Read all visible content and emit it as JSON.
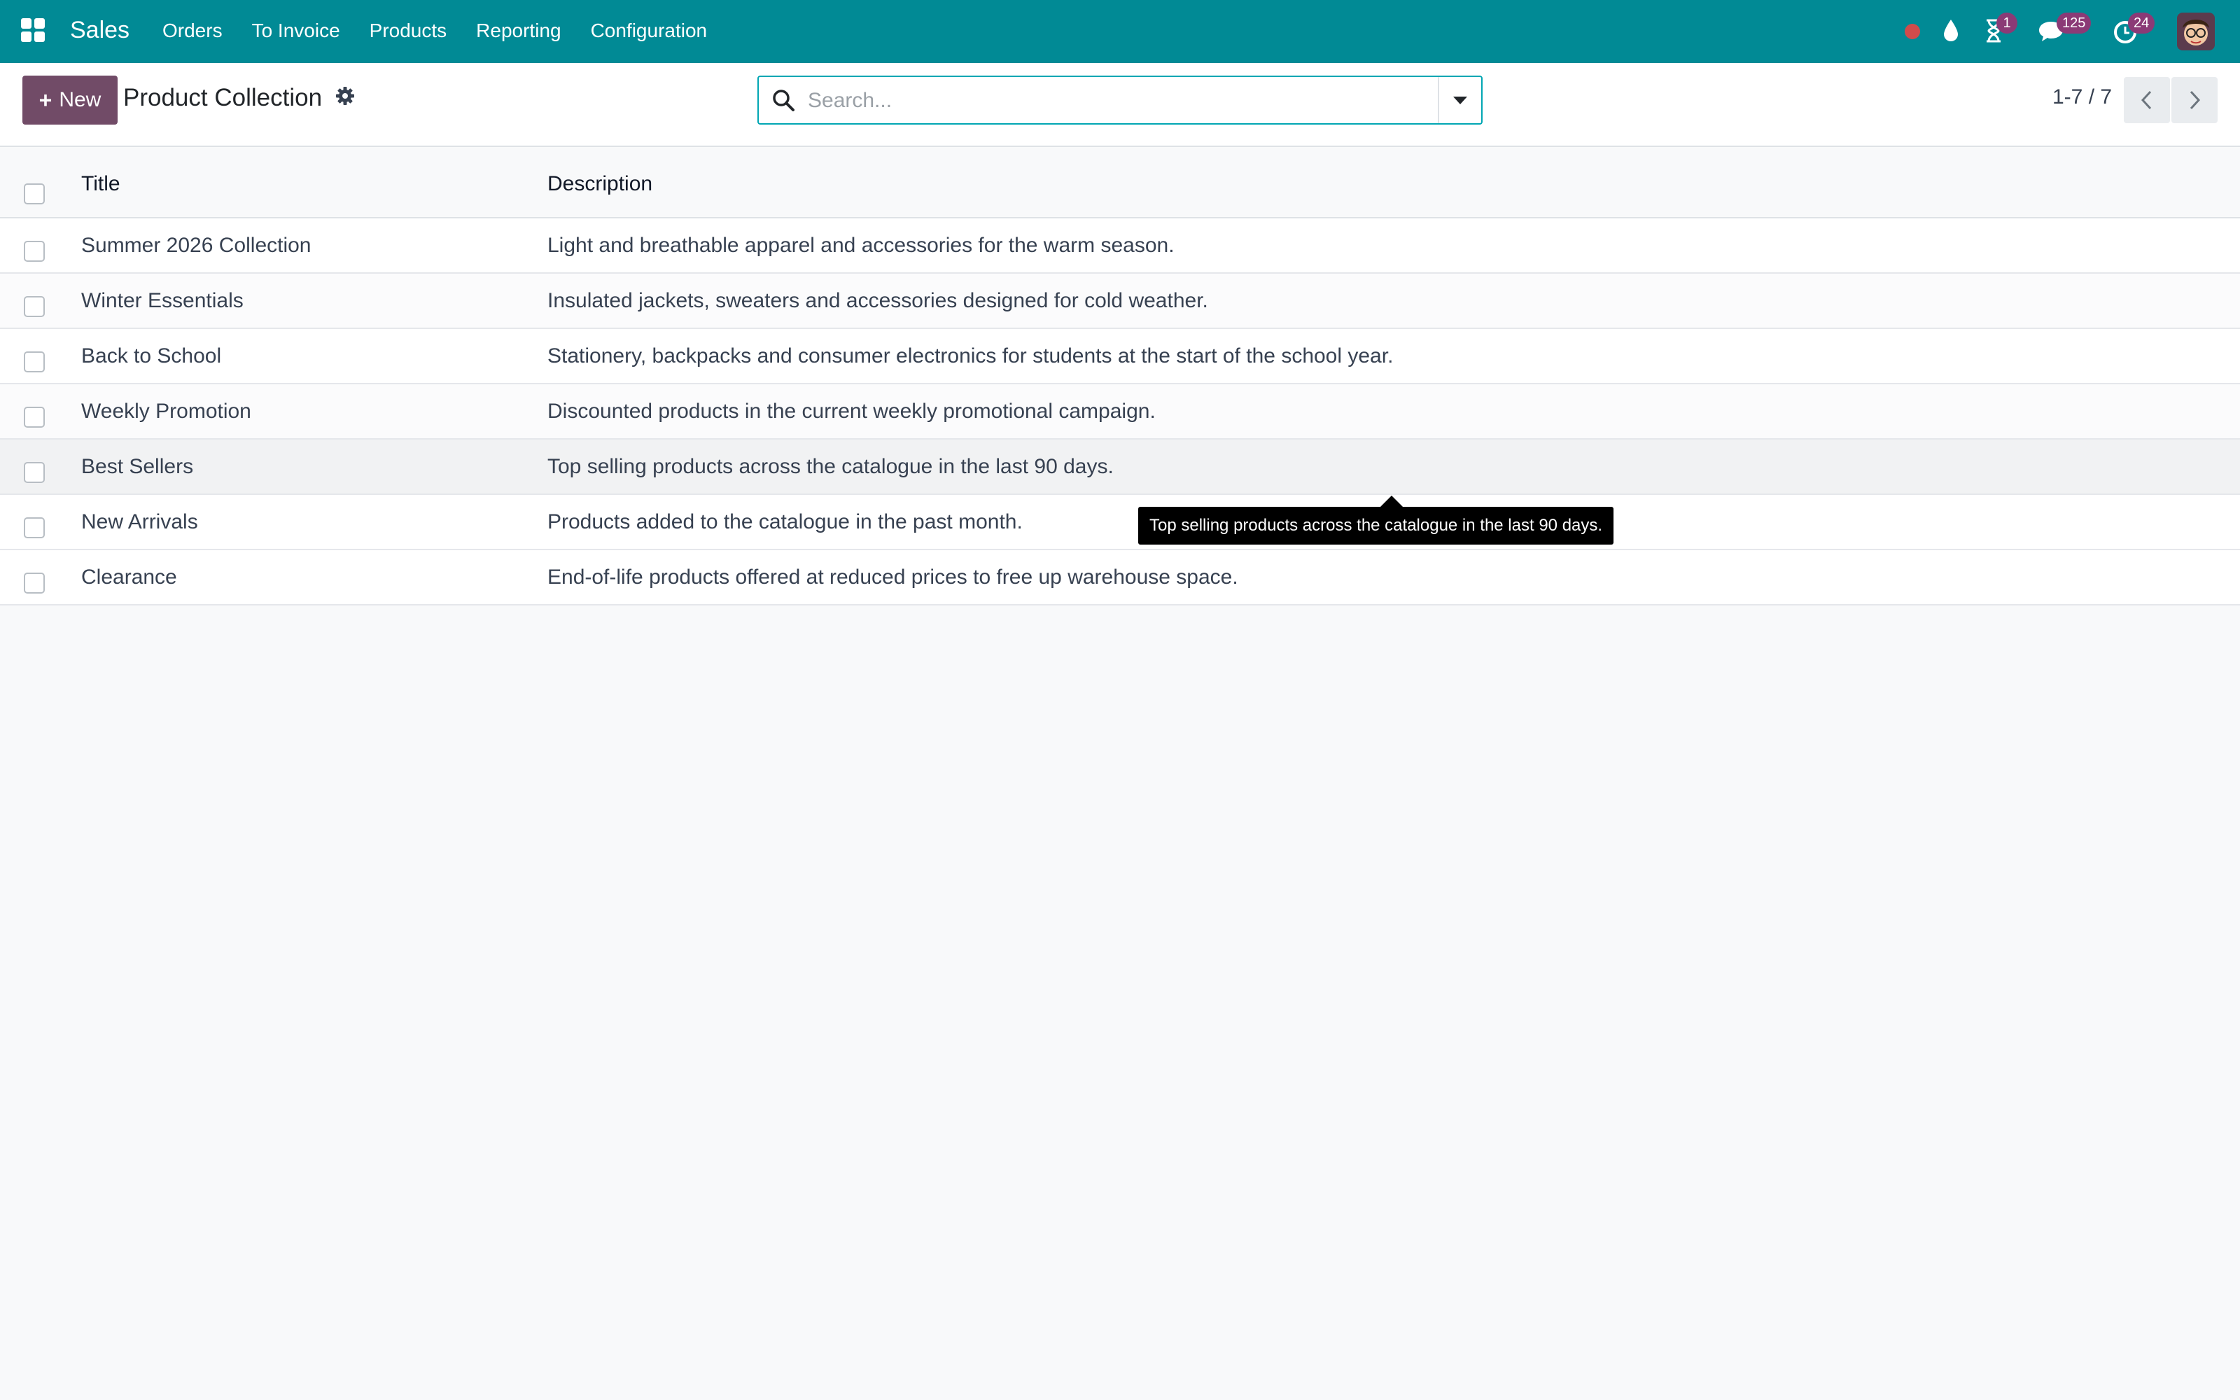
{
  "navbar": {
    "brand": "Sales",
    "menu": [
      "Orders",
      "To Invoice",
      "Products",
      "Reporting",
      "Configuration"
    ],
    "badges": {
      "activities": "1",
      "messages": "125",
      "clock": "24"
    },
    "colors": {
      "navbar": "#018a95",
      "badge": "#8b3a76",
      "record": "#d04b4b"
    }
  },
  "control_panel": {
    "new_label": "New",
    "title": "Product Collection",
    "search_placeholder": "Search...",
    "pager": "1-7 / 7"
  },
  "list": {
    "columns": [
      "Title",
      "Description"
    ],
    "rows": [
      {
        "title": "Summer 2026 Collection",
        "description": "Light and breathable apparel and accessories for the warm season."
      },
      {
        "title": "Winter Essentials",
        "description": "Insulated jackets, sweaters and accessories designed for cold weather."
      },
      {
        "title": "Back to School",
        "description": "Stationery, backpacks and consumer electronics for students at the start of the school year."
      },
      {
        "title": "Weekly Promotion",
        "description": "Discounted products in the current weekly promotional campaign."
      },
      {
        "title": "Best Sellers",
        "description": "Top selling products across the catalogue in the last 90 days."
      },
      {
        "title": "New Arrivals",
        "description": "Products added to the catalogue in the past month."
      },
      {
        "title": "Clearance",
        "description": "End-of-life products offered at reduced prices to free up warehouse space."
      }
    ]
  },
  "tooltip": {
    "text": "Top selling products across the catalogue in the last 90 days."
  },
  "colors": {
    "accent": "#714b67",
    "search_border": "#01a6b3"
  }
}
